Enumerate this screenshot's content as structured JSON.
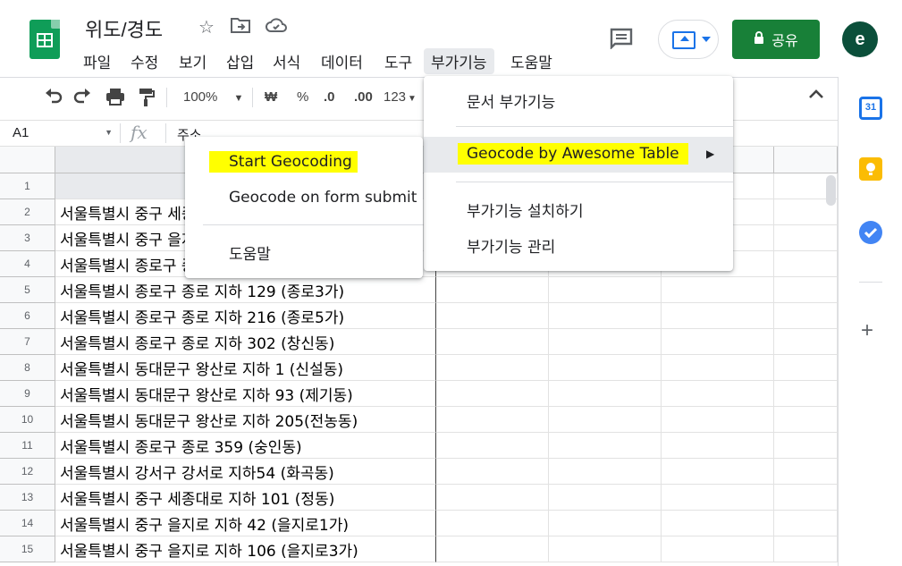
{
  "doc": {
    "title": "위도/경도"
  },
  "menubar": [
    "파일",
    "수정",
    "보기",
    "삽입",
    "서식",
    "데이터",
    "도구",
    "부가기능",
    "도움말"
  ],
  "share": {
    "label": "공유"
  },
  "avatar": {
    "initial": "e"
  },
  "toolbar": {
    "zoom": "100%",
    "currency": "₩",
    "percent": "%",
    "dec_less": ".0",
    "dec_more": ".00",
    "format_123": "123"
  },
  "formula": {
    "name_box": "A1",
    "fx": "fx",
    "value": "주소"
  },
  "rows": [
    {
      "num": "1",
      "addr": ""
    },
    {
      "num": "2",
      "addr": "서울특별시 중구 세종대로 지하 2 (태평로1가)"
    },
    {
      "num": "3",
      "addr": "서울특별시 중구 을지로 지하 (을지로1가)"
    },
    {
      "num": "4",
      "addr": "서울특별시 종로구 종로 지하 (종로1가)"
    },
    {
      "num": "5",
      "addr": "서울특별시 종로구 종로 지하 129 (종로3가)"
    },
    {
      "num": "6",
      "addr": "서울특별시 종로구 종로 지하 216 (종로5가)"
    },
    {
      "num": "7",
      "addr": "서울특별시 종로구 종로 지하 302 (창신동)"
    },
    {
      "num": "8",
      "addr": "서울특별시 동대문구 왕산로 지하 1 (신설동)"
    },
    {
      "num": "9",
      "addr": "서울특별시 동대문구 왕산로 지하 93 (제기동)"
    },
    {
      "num": "10",
      "addr": "서울특별시 동대문구 왕산로 지하 205(전농동)"
    },
    {
      "num": "11",
      "addr": "서울특별시 종로구 종로 359 (숭인동)"
    },
    {
      "num": "12",
      "addr": "서울특별시 강서구 강서로 지하54 (화곡동)"
    },
    {
      "num": "13",
      "addr": "서울특별시 중구 세종대로 지하 101 (정동)"
    },
    {
      "num": "14",
      "addr": "서울특별시 중구 을지로 지하 42 (을지로1가)"
    },
    {
      "num": "15",
      "addr": "서울특별시 중구 을지로 지하 106 (을지로3가)"
    }
  ],
  "addons_menu": {
    "doc_addons": "문서 부가기능",
    "geocode": "Geocode by Awesome Table",
    "install": "부가기능 설치하기",
    "manage": "부가기능 관리"
  },
  "geocode_submenu": {
    "start": "Start Geocoding",
    "on_submit": "Geocode on form submit",
    "help": "도움말"
  },
  "colors": {
    "brand_green": "#0f9d58",
    "share_green": "#188038",
    "highlight": "#ffff00",
    "accent_blue": "#1a73e8"
  }
}
